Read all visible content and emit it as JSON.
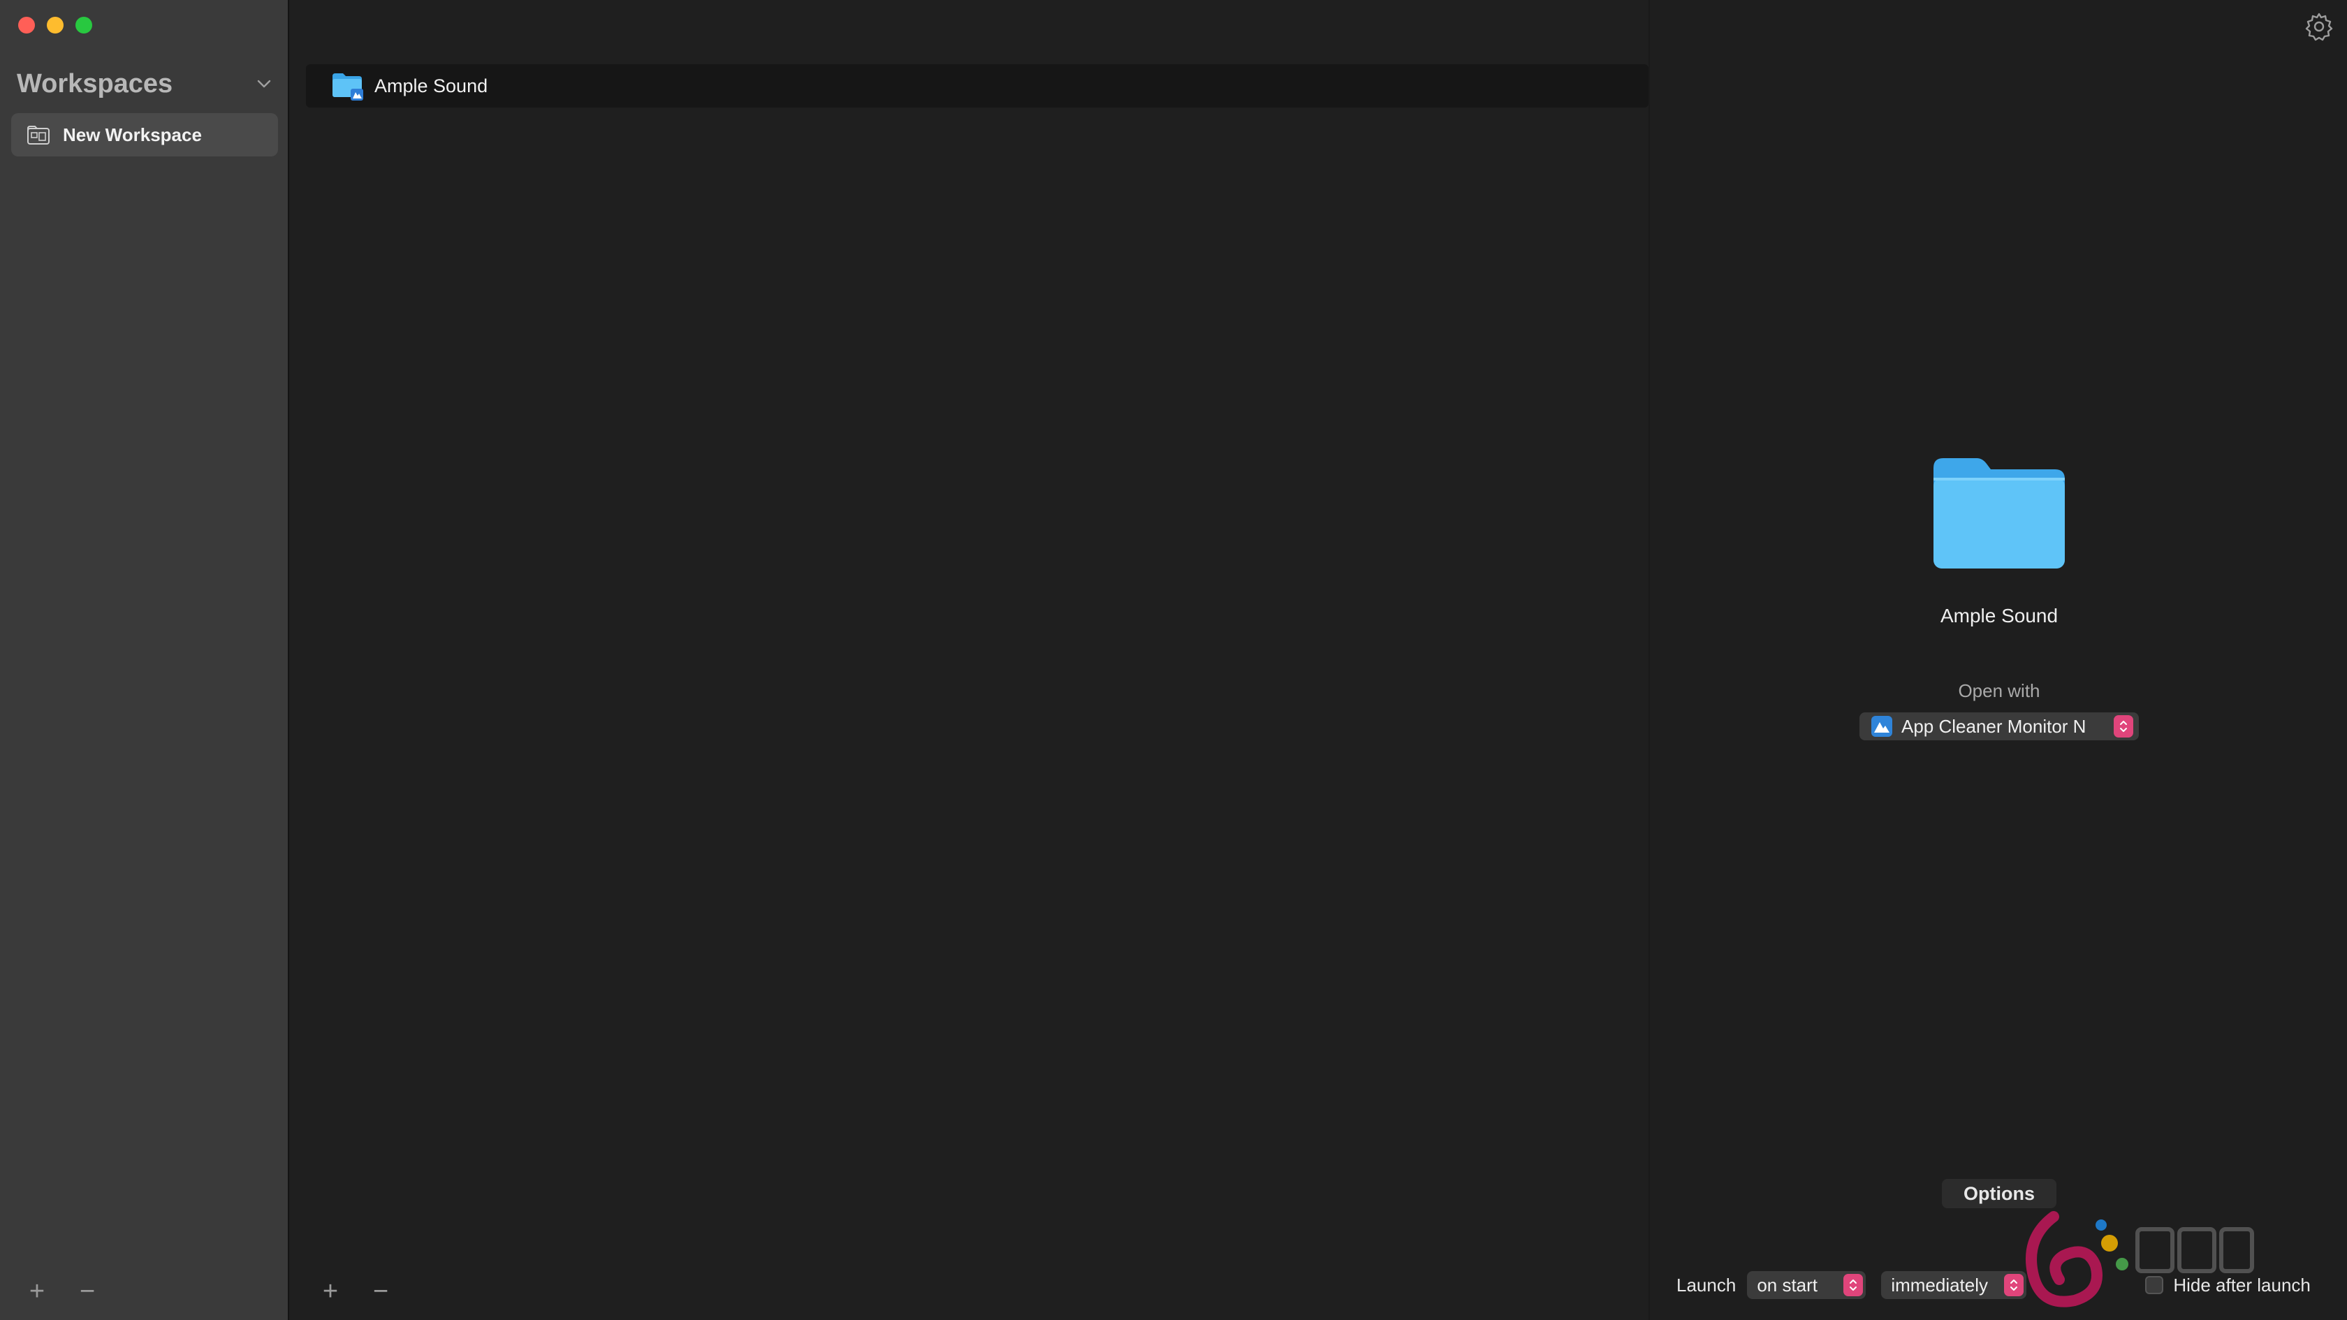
{
  "sidebar": {
    "title": "Workspaces",
    "items": [
      {
        "label": "New Workspace",
        "icon": "workspace-icon",
        "selected": true
      }
    ],
    "footer": {
      "add": "+",
      "remove": "−"
    }
  },
  "list": {
    "items": [
      {
        "label": "Ample Sound",
        "icon": "folder-icon"
      }
    ],
    "footer": {
      "add": "+",
      "remove": "−"
    }
  },
  "detail": {
    "name": "Ample Sound",
    "open_with_label": "Open with",
    "open_with_value": "App Cleaner Monitor N",
    "options_label": "Options",
    "launch_label": "Launch",
    "launch_when": "on start",
    "launch_delay": "immediately",
    "hide_after_launch_label": "Hide after launch",
    "hide_after_launch": false
  },
  "colors": {
    "folder": "#4cb9f3",
    "accent": "#e0457b",
    "traffic_close": "#ff5f57",
    "traffic_min": "#febc2e",
    "traffic_max": "#28c840"
  }
}
